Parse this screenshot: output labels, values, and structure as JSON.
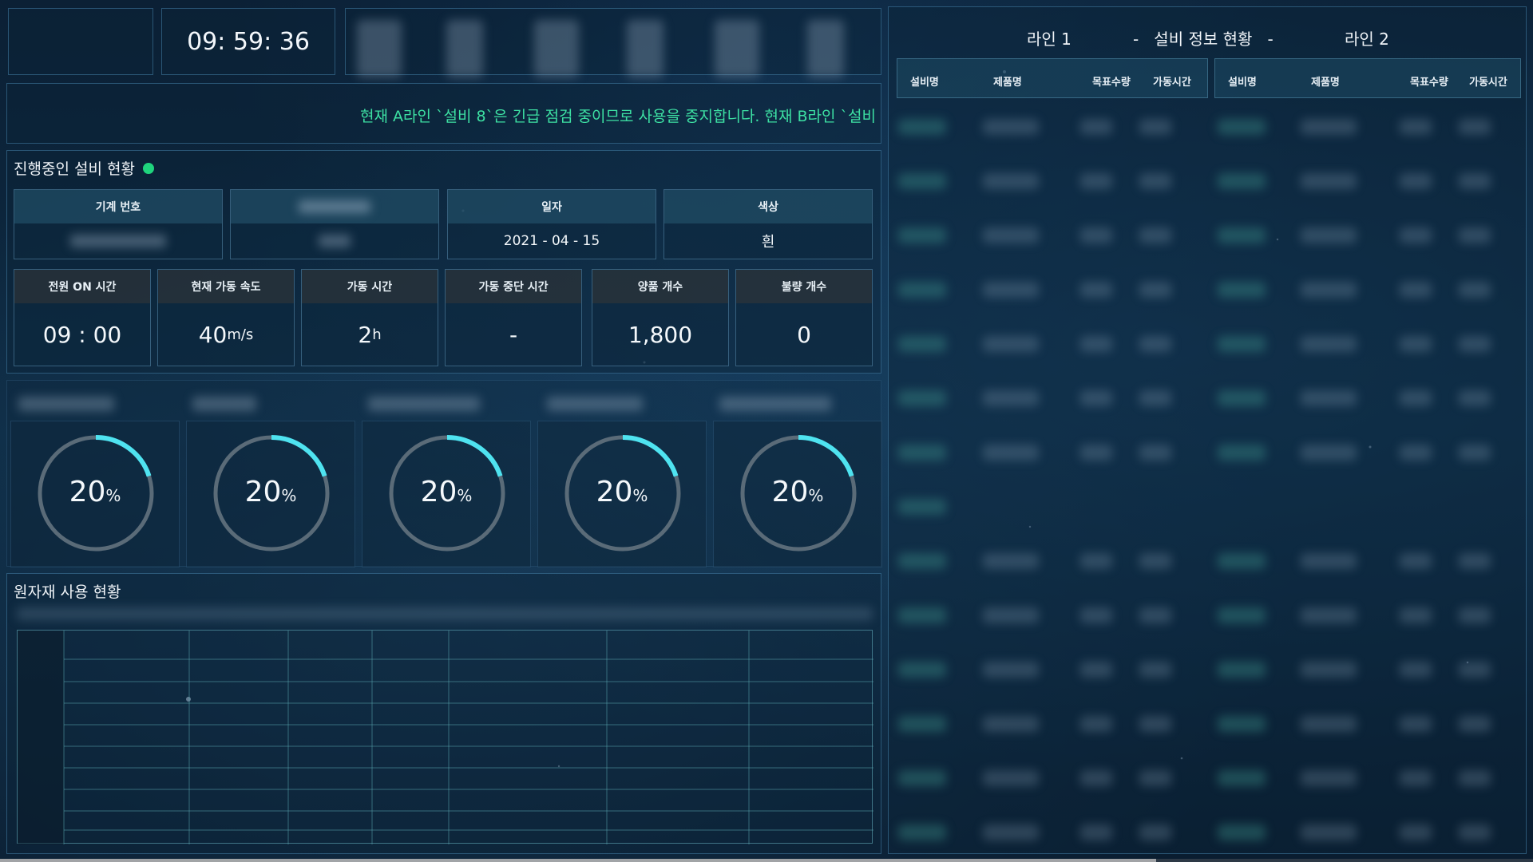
{
  "header": {
    "clock": "09: 59: 36"
  },
  "ticker": {
    "message": "현재 A라인 `설비 8`은 긴급 점검 중이므로 사용을 중지합니다. 현재 B라인 `설비"
  },
  "equipment_status": {
    "title": "진행중인 설비 현황",
    "status_color": "#1fd47d",
    "info": [
      {
        "label": "기계 번호",
        "value": ""
      },
      {
        "label": "",
        "value": ""
      },
      {
        "label": "일자",
        "value": "2021 - 04 - 15"
      },
      {
        "label": "색상",
        "value": "흰"
      }
    ],
    "metrics": [
      {
        "label": "전원 ON 시간",
        "value": "09 : 00",
        "unit": ""
      },
      {
        "label": "현재 가동 속도",
        "value": "40",
        "unit": "m/s"
      },
      {
        "label": "가동 시간",
        "value": "2",
        "unit": "h"
      },
      {
        "label": "가동 중단 시간",
        "value": "-",
        "unit": ""
      },
      {
        "label": "양품 개수",
        "value": "1,800",
        "unit": ""
      },
      {
        "label": "불량 개수",
        "value": "0",
        "unit": ""
      }
    ]
  },
  "gauges": [
    {
      "value": "20",
      "unit": "%",
      "fraction": 0.2
    },
    {
      "value": "20",
      "unit": "%",
      "fraction": 0.2
    },
    {
      "value": "20",
      "unit": "%",
      "fraction": 0.2
    },
    {
      "value": "20",
      "unit": "%",
      "fraction": 0.2
    },
    {
      "value": "20",
      "unit": "%",
      "fraction": 0.2
    }
  ],
  "gauge_colors": {
    "track": "#5a6b78",
    "arc": "#4fe3f0"
  },
  "raw_material": {
    "title": "원자재 사용 현황"
  },
  "right_panel": {
    "line1": "라인 1",
    "title": "-   설비 정보 현황   -",
    "line2": "라인 2",
    "columns": [
      "설비명",
      "제품명",
      "목표수량",
      "가동시간"
    ]
  }
}
